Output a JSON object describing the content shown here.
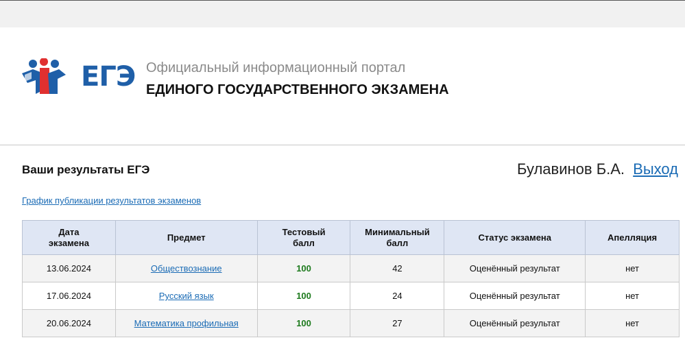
{
  "header": {
    "logo_text": "ЕГЭ",
    "portal_line1": "Официальный информационный портал",
    "portal_line2": "ЕДИНОГО ГОСУДАРСТВЕННОГО ЭКЗАМЕНА"
  },
  "results": {
    "title": "Ваши результаты ЕГЭ",
    "user_name": "Булавинов Б.А.",
    "logout_label": "Выход",
    "schedule_link": "График публикации результатов экзаменов"
  },
  "table": {
    "headers": {
      "date_line1": "Дата",
      "date_line2": "экзамена",
      "subject": "Предмет",
      "score_line1": "Тестовый",
      "score_line2": "балл",
      "min_line1": "Минимальный",
      "min_line2": "балл",
      "status": "Статус экзамена",
      "appeal": "Апелляция"
    },
    "rows": [
      {
        "date": "13.06.2024",
        "subject": "Обществознание",
        "score": "100",
        "min": "42",
        "status": "Оценённый результат",
        "appeal": "нет"
      },
      {
        "date": "17.06.2024",
        "subject": "Русский язык",
        "score": "100",
        "min": "24",
        "status": "Оценённый результат",
        "appeal": "нет"
      },
      {
        "date": "20.06.2024",
        "subject": "Математика профильная",
        "score": "100",
        "min": "27",
        "status": "Оценённый результат",
        "appeal": "нет"
      }
    ]
  },
  "colors": {
    "link": "#1a6bb5",
    "score_green": "#1d7a1d",
    "header_bg": "#dfe6f4",
    "logo_blue": "#1f5fa8",
    "logo_red": "#e03030"
  }
}
